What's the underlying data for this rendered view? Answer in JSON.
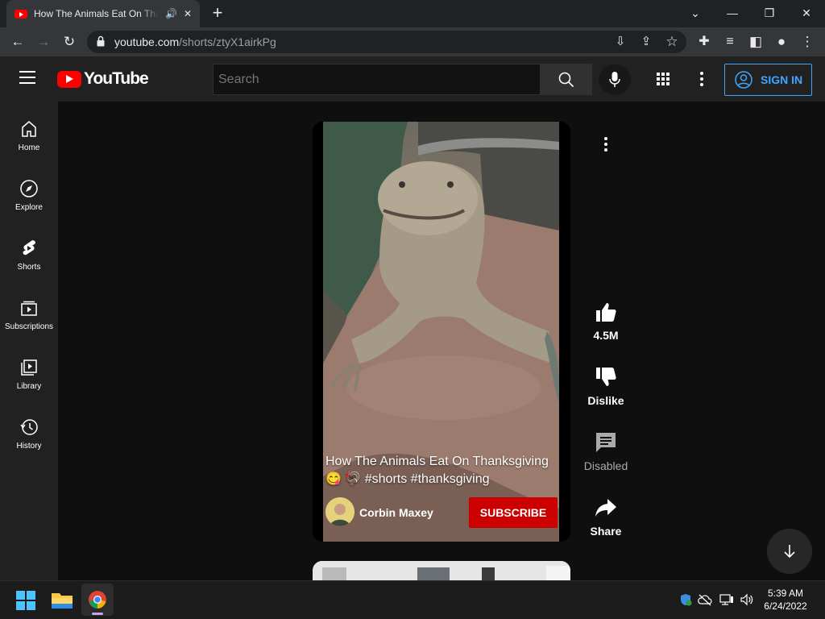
{
  "browser": {
    "tab_title": "How The Animals Eat On Thanksgiving",
    "new_tab": "+",
    "url_domain": "youtube.com",
    "url_path": "/shorts/ztyX1airkPg"
  },
  "youtube": {
    "logo_text": "YouTube",
    "search_placeholder": "Search",
    "sign_in": "SIGN IN",
    "sidebar": [
      {
        "label": "Home",
        "icon": "home-icon"
      },
      {
        "label": "Explore",
        "icon": "compass-icon"
      },
      {
        "label": "Shorts",
        "icon": "shorts-icon"
      },
      {
        "label": "Subscriptions",
        "icon": "subscriptions-icon"
      },
      {
        "label": "Library",
        "icon": "library-icon"
      },
      {
        "label": "History",
        "icon": "history-icon"
      }
    ],
    "short": {
      "title_line1": "How The Animals Eat On Thanksgiving",
      "title_line2": "#shorts #thanksgiving",
      "channel": "Corbin Maxey",
      "subscribe": "SUBSCRIBE"
    },
    "actions": {
      "likes": "4.5M",
      "dislike": "Dislike",
      "comments": "Disabled",
      "share": "Share"
    },
    "colors": {
      "brand_red": "#ff0000",
      "subscribe_red": "#cc0000",
      "accent_blue": "#3ea6ff"
    }
  },
  "taskbar": {
    "time": "5:39 AM",
    "date": "6/24/2022"
  }
}
